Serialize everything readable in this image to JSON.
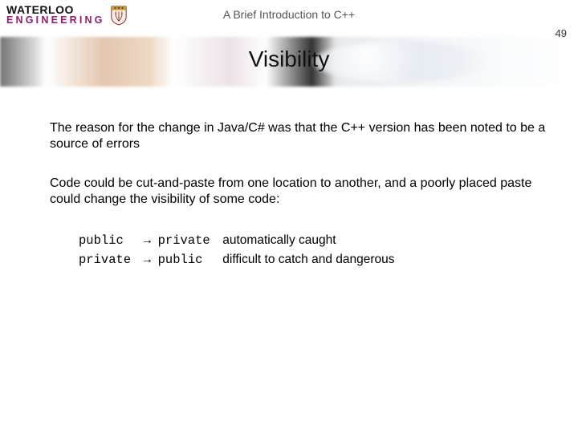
{
  "header": {
    "wordmark_top": "WATERLOO",
    "wordmark_bottom": "ENGINEERING",
    "doc_title": "A Brief Introduction to C++",
    "page_number": "49"
  },
  "slide": {
    "title": "Visibility"
  },
  "body": {
    "para1": "The reason for the change in Java/C# was that the C++ version has been noted to be a source of errors",
    "para2": "Code could be cut-and-paste from one location to another, and a poorly placed paste could change the visibility of some code:",
    "ex1_from": "public",
    "ex1_arrow": "→",
    "ex1_to": "private",
    "ex1_note": "automatically caught",
    "ex2_from": "private",
    "ex2_arrow": "→",
    "ex2_to": "public",
    "ex2_note": "difficult to catch and dangerous"
  }
}
